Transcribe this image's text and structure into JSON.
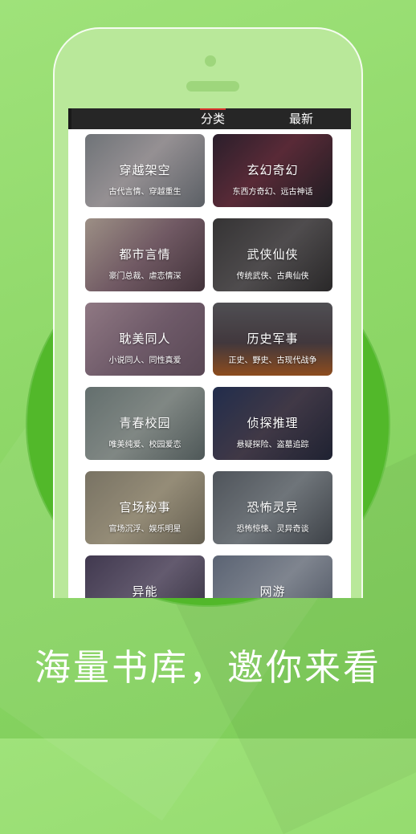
{
  "tabs": [
    {
      "label": "分类",
      "active": true
    },
    {
      "label": "最新",
      "active": false
    }
  ],
  "categories": [
    {
      "title": "穿越架空",
      "subtitle": "古代言情、穿越重生",
      "bg": "linear-gradient(135deg,#9aa0a6,#cfc8cc 45%,#7f858d)"
    },
    {
      "title": "玄幻奇幻",
      "subtitle": "东西方奇幻、远古神话",
      "bg": "linear-gradient(135deg,#3b2b3c,#7c3b4d 45%,#2b2830)"
    },
    {
      "title": "都市言情",
      "subtitle": "豪门总裁、虐恋情深",
      "bg": "linear-gradient(135deg,#d9c7b9,#9c7c8a 50%,#5b4650)"
    },
    {
      "title": "武侠仙侠",
      "subtitle": "传统武侠、古典仙侠",
      "bg": "linear-gradient(135deg,#4a4849,#6e6a6c 50%,#3a3839)"
    },
    {
      "title": "耽美同人",
      "subtitle": "小说同人、同性真爱",
      "bg": "linear-gradient(135deg,#c7a7b6,#9a7e92 50%,#7c6476)"
    },
    {
      "title": "历史军事",
      "subtitle": "正史、野史、古现代战争",
      "bg": "linear-gradient(180deg,#6f6e74,#5b4e55 55%,#c46a2a)"
    },
    {
      "title": "青春校园",
      "subtitle": "唯美纯爱、校园爱恋",
      "bg": "linear-gradient(135deg,#8a9a98,#b2bcb7 50%,#6d7a7a)"
    },
    {
      "title": "侦探推理",
      "subtitle": "悬疑探险、盗墓追踪",
      "bg": "linear-gradient(135deg,#2f3f6a,#5a4f62 50%,#2b2f45)"
    },
    {
      "title": "官场秘事",
      "subtitle": "官场沉浮、娱乐明星",
      "bg": "linear-gradient(135deg,#a79f8a,#cfc3a6 50%,#8c8470)"
    },
    {
      "title": "恐怖灵异",
      "subtitle": "恐怖惊悚、灵异奇谈",
      "bg": "linear-gradient(135deg,#6e757e,#9aa2a9 50%,#565c64)"
    },
    {
      "title": "异能",
      "subtitle": "",
      "bg": "linear-gradient(135deg,#5a4f6e,#8a7e9a 50%,#4a4458)"
    },
    {
      "title": "网游",
      "subtitle": "",
      "bg": "linear-gradient(135deg,#7e8aa0,#b0b8c6 50%,#6a7386)"
    }
  ],
  "slogan": "海量书库，邀你来看"
}
